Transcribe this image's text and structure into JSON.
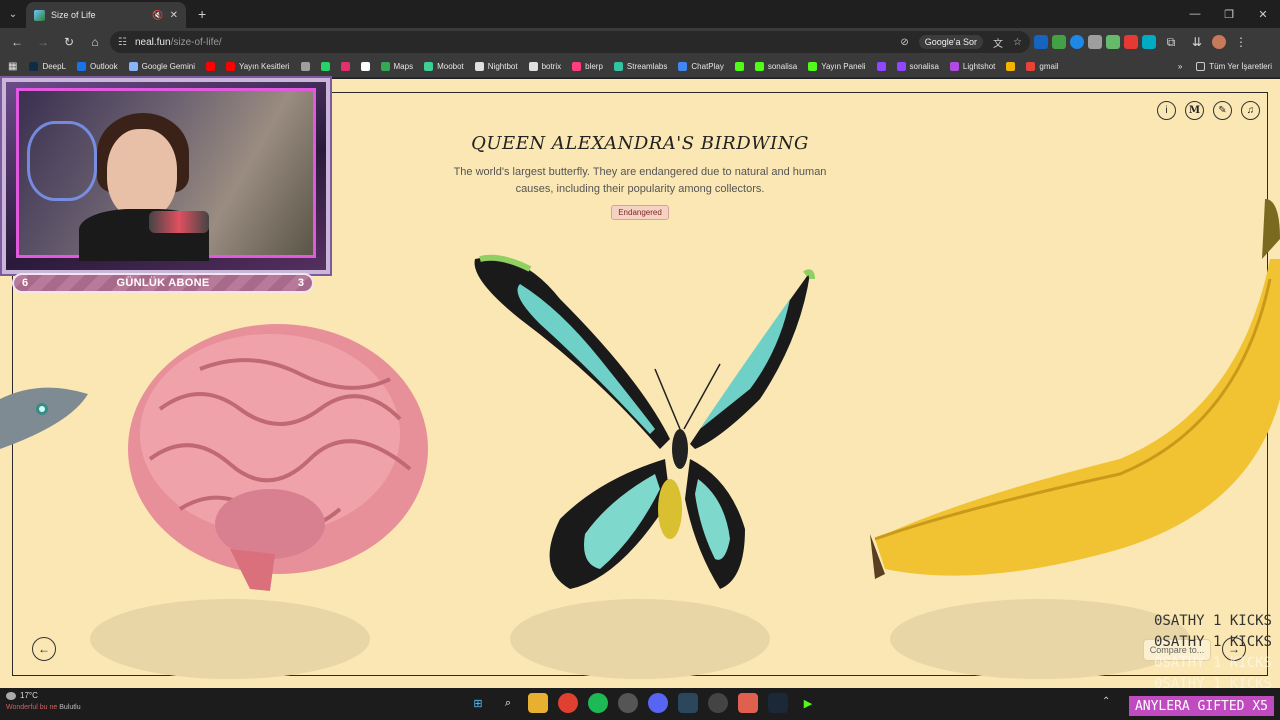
{
  "browser": {
    "tab_title": "Size of Life",
    "new_tab_symbol": "+",
    "url_host": "neal.fun",
    "url_path": "/size-of-life/",
    "google_sor": "Google'a Sor",
    "bookmarks": [
      {
        "label": "DeepL",
        "color": "#0f2b46"
      },
      {
        "label": "Outlook",
        "color": "#1a73e8"
      },
      {
        "label": "Google Gemini",
        "color": "#8ab4f8"
      },
      {
        "label": "",
        "color": "#ff0000"
      },
      {
        "label": "Yayın Kesitleri",
        "color": "#ff0000"
      },
      {
        "label": "",
        "color": "#9e9e9e"
      },
      {
        "label": "",
        "color": "#25d366"
      },
      {
        "label": "",
        "color": "#e1306c"
      },
      {
        "label": "",
        "color": "#ffffff"
      },
      {
        "label": "Maps",
        "color": "#34a853"
      },
      {
        "label": "Moobot",
        "color": "#3ccf91"
      },
      {
        "label": "Nightbot",
        "color": "#e0e0e0"
      },
      {
        "label": "botrix",
        "color": "#e0e0e0"
      },
      {
        "label": "blerp",
        "color": "#ff3d7f"
      },
      {
        "label": "Streamlabs",
        "color": "#31c3a2"
      },
      {
        "label": "ChatPlay",
        "color": "#4285f4"
      },
      {
        "label": "",
        "color": "#53fc18"
      },
      {
        "label": "sonalisa",
        "color": "#53fc18"
      },
      {
        "label": "Yayın Paneli",
        "color": "#53fc18"
      },
      {
        "label": "",
        "color": "#9146ff"
      },
      {
        "label": "sonalisa",
        "color": "#9146ff"
      },
      {
        "label": "Lightshot",
        "color": "#b04ae0"
      },
      {
        "label": "",
        "color": "#f4b400"
      },
      {
        "label": "gmail",
        "color": "#ea4335"
      }
    ],
    "all_bookmarks": "Tüm Yer İşaretleri"
  },
  "page": {
    "title": "QUEEN ALEXANDRA'S BIRDWING",
    "description": "The world's largest butterfly. They are endangered due to natural and human causes, including their popularity among collectors.",
    "status_badge": "Endangered",
    "compare_label": "Compare to...",
    "icons": {
      "info": "info-icon",
      "medium": "M",
      "pencil": "pencil-icon",
      "music": "music-icon"
    }
  },
  "stream_overlay": {
    "sub_left": "6",
    "sub_label": "GÜNLÜK ABONE",
    "sub_right": "3",
    "kicks": [
      "0SATHY  1 KICKS",
      "0SATHY  1 KICKS",
      "0SATHY  1 KICKS",
      "0SATHY  1 KICKS"
    ],
    "gifted": "ANYLERA  GIFTED X5"
  },
  "taskbar": {
    "temperature": "17°C",
    "weather_desc": "Bulutlu",
    "notif": "Wonderful bu ne"
  },
  "colors": {
    "page_bg": "#fae7b3",
    "badge_bg": "#f6d2c2",
    "accent_pink": "#c04ac0"
  }
}
